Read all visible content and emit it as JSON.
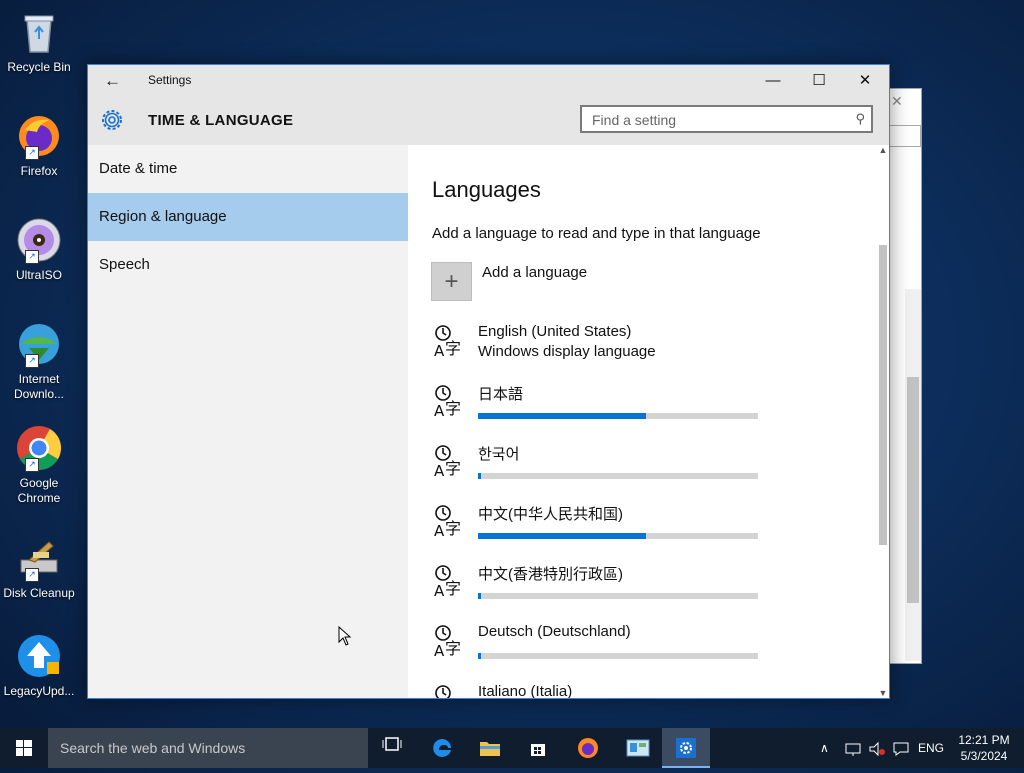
{
  "desktop": {
    "icons": [
      {
        "label": "Recycle Bin",
        "icon": "recycle-bin-icon"
      },
      {
        "label": "Firefox",
        "icon": "firefox-icon"
      },
      {
        "label": "UltraISO",
        "icon": "ultraiso-icon"
      },
      {
        "label": "Internet Downlo...",
        "label_line1": "Internet",
        "label_line2": "Downlo...",
        "icon": "idm-icon"
      },
      {
        "label": "Google Chrome",
        "label_line1": "Google",
        "label_line2": "Chrome",
        "icon": "chrome-icon"
      },
      {
        "label": "Disk Cleanup",
        "icon": "disk-cleanup-icon"
      },
      {
        "label": "LegacyUpd...",
        "icon": "legacy-update-icon"
      }
    ]
  },
  "window": {
    "title": "Settings",
    "back_icon": "back-arrow-icon",
    "controls": {
      "minimize": "—",
      "maximize": "☐",
      "close": "✕"
    },
    "header_title": "TIME & LANGUAGE",
    "search_placeholder": "Find a setting"
  },
  "sidebar": {
    "items": [
      {
        "label": "Date & time",
        "selected": false
      },
      {
        "label": "Region & language",
        "selected": true
      },
      {
        "label": "Speech",
        "selected": false
      }
    ]
  },
  "content": {
    "heading": "Languages",
    "description": "Add a language to read and type in that language",
    "add_label": "Add a language",
    "languages": [
      {
        "name": "English (United States)",
        "sub": "Windows display language",
        "progress": null
      },
      {
        "name": "日本語",
        "progress": 0.6
      },
      {
        "name": "한국어",
        "progress": 0.01
      },
      {
        "name": "中文(中华人民共和国)",
        "progress": 0.6
      },
      {
        "name": "中文(香港特別行政區)",
        "progress": 0.01
      },
      {
        "name": "Deutsch (Deutschland)",
        "progress": 0.01
      },
      {
        "name": "Italiano (Italia)",
        "progress": null
      }
    ]
  },
  "taskbar": {
    "search_placeholder": "Search the web and Windows",
    "tray_lang": "ENG",
    "time": "12:21 PM",
    "date": "5/3/2024"
  },
  "colors": {
    "accent": "#0a74d6",
    "selection": "#a5cbed",
    "taskbar": "#101d2f"
  }
}
